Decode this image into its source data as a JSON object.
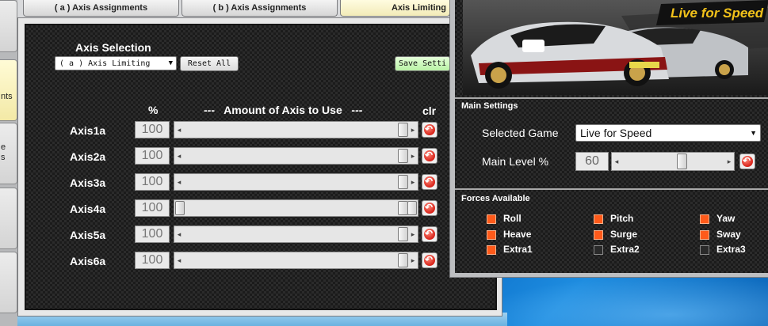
{
  "left_window": {
    "tabs": [
      {
        "label": "nts"
      },
      {
        "label": "e\ns"
      }
    ]
  },
  "tabs": [
    {
      "label": "( a ) Axis Assignments"
    },
    {
      "label": "( b ) Axis Assignments"
    },
    {
      "label": "Axis Limiting"
    }
  ],
  "axis_panel": {
    "section_label": "Axis Selection",
    "selection_combo": "( a ) Axis Limiting",
    "reset_all_label": "Reset All",
    "save_label": "Save Setti",
    "col_percent": "%",
    "col_amount": "---   Amount of Axis to Use   ---",
    "col_clr": "clr",
    "rows": [
      {
        "name": "Axis1a",
        "value": "100",
        "level": 1.0
      },
      {
        "name": "Axis2a",
        "value": "100",
        "level": 1.0
      },
      {
        "name": "Axis3a",
        "value": "100",
        "level": 1.0
      },
      {
        "name": "Axis4a",
        "value": "100",
        "level": 1.0
      },
      {
        "name": "Axis5a",
        "value": "100",
        "level": 1.0
      },
      {
        "name": "Axis6a",
        "value": "100",
        "level": 1.0
      }
    ]
  },
  "right_window": {
    "banner_logo": "Live for Speed",
    "main_settings_title": "Main Settings",
    "selected_game_label": "Selected Game",
    "selected_game_value": "Live for Speed",
    "main_level_label": "Main Level %",
    "main_level_value": "60",
    "main_level_fraction": 0.6,
    "forces_title": "Forces Available",
    "forces": [
      {
        "label": "Roll",
        "checked": true
      },
      {
        "label": "Pitch",
        "checked": true
      },
      {
        "label": "Yaw",
        "checked": true
      },
      {
        "label": "Heave",
        "checked": true
      },
      {
        "label": "Surge",
        "checked": true
      },
      {
        "label": "Sway",
        "checked": true
      },
      {
        "label": "Extra1",
        "checked": true
      },
      {
        "label": "Extra2",
        "checked": false
      },
      {
        "label": "Extra3",
        "checked": false
      }
    ]
  },
  "colors": {
    "check_on": "#ff5a1a",
    "save_button": "#b9f2a5",
    "active_tab": "#f2ebb8"
  }
}
